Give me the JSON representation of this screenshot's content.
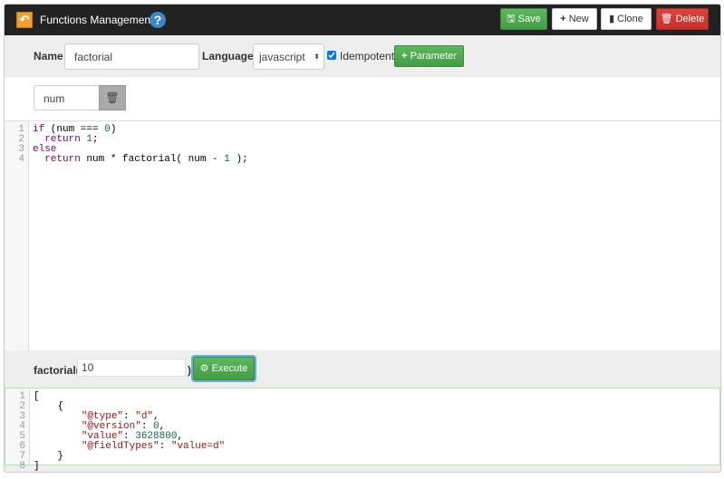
{
  "header": {
    "title": "Functions Management",
    "help": "?",
    "back_icon": "undo-arrow-icon",
    "buttons": {
      "save": "Save",
      "new": "New",
      "clone": "Clone",
      "delete": "Delete"
    }
  },
  "form": {
    "name_label": "Name",
    "name_value": "factorial",
    "language_label": "Language",
    "language_value": "javascript",
    "idempotent_label": "Idempotent",
    "idempotent_checked": true,
    "add_parameter": "Parameter"
  },
  "parameters": [
    {
      "value": "num"
    }
  ],
  "editor": {
    "lines": [
      [
        {
          "t": "if",
          "c": "kw"
        },
        {
          "t": " (num === ",
          "c": "pl"
        },
        {
          "t": "0",
          "c": "num"
        },
        {
          "t": ")",
          "c": "pl"
        }
      ],
      [
        {
          "t": "  ",
          "c": "pl"
        },
        {
          "t": "return",
          "c": "kw"
        },
        {
          "t": " ",
          "c": "pl"
        },
        {
          "t": "1",
          "c": "num"
        },
        {
          "t": ";",
          "c": "pl"
        }
      ],
      [
        {
          "t": "else",
          "c": "kw"
        }
      ],
      [
        {
          "t": "  ",
          "c": "pl"
        },
        {
          "t": "return",
          "c": "kw"
        },
        {
          "t": " num * factorial( num - ",
          "c": "pl"
        },
        {
          "t": "1",
          "c": "num"
        },
        {
          "t": " );",
          "c": "pl"
        }
      ]
    ]
  },
  "execute": {
    "prefix": "factorial(",
    "arg": "10",
    "suffix": ")",
    "button": "Execute"
  },
  "result": {
    "lines": [
      [
        {
          "t": "[",
          "c": "pl"
        }
      ],
      [
        {
          "t": "    {",
          "c": "pl"
        }
      ],
      [
        {
          "t": "        ",
          "c": "pl"
        },
        {
          "t": "\"@type\"",
          "c": "str"
        },
        {
          "t": ": ",
          "c": "pl"
        },
        {
          "t": "\"d\"",
          "c": "str"
        },
        {
          "t": ",",
          "c": "pl"
        }
      ],
      [
        {
          "t": "        ",
          "c": "pl"
        },
        {
          "t": "\"@version\"",
          "c": "str"
        },
        {
          "t": ": ",
          "c": "pl"
        },
        {
          "t": "0",
          "c": "num"
        },
        {
          "t": ",",
          "c": "pl"
        }
      ],
      [
        {
          "t": "        ",
          "c": "pl"
        },
        {
          "t": "\"value\"",
          "c": "str"
        },
        {
          "t": ": ",
          "c": "pl"
        },
        {
          "t": "3628800",
          "c": "num"
        },
        {
          "t": ",",
          "c": "pl"
        }
      ],
      [
        {
          "t": "        ",
          "c": "pl"
        },
        {
          "t": "\"@fieldTypes\"",
          "c": "str"
        },
        {
          "t": ": ",
          "c": "pl"
        },
        {
          "t": "\"value=d\"",
          "c": "str"
        }
      ],
      [
        {
          "t": "    }",
          "c": "pl"
        }
      ],
      [
        {
          "t": "]",
          "c": "pl"
        }
      ]
    ]
  }
}
